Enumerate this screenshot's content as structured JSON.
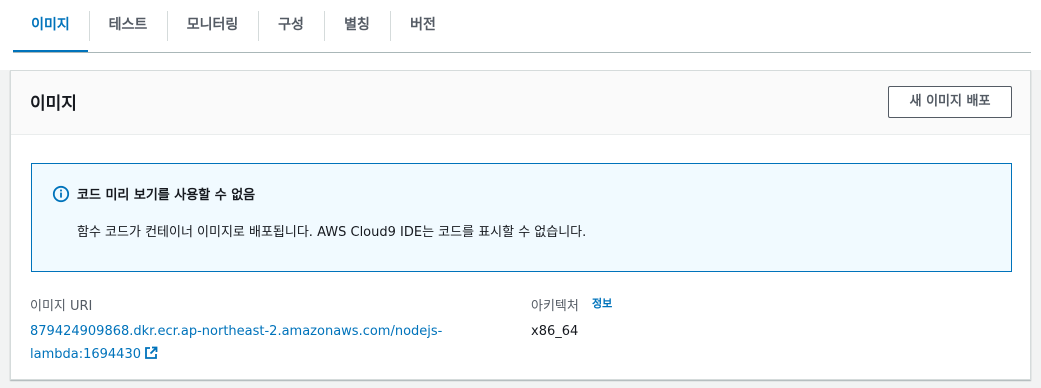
{
  "tabs": [
    {
      "label": "이미지",
      "active": true
    },
    {
      "label": "테스트",
      "active": false
    },
    {
      "label": "모니터링",
      "active": false
    },
    {
      "label": "구성",
      "active": false
    },
    {
      "label": "별칭",
      "active": false
    },
    {
      "label": "버전",
      "active": false
    }
  ],
  "panel": {
    "title": "이미지",
    "deploy_button_label": "새 이미지 배포"
  },
  "alert": {
    "icon": "info-icon",
    "title": "코드 미리 보기를 사용할 수 없음",
    "body": "함수 코드가 컨테이너 이미지로 배포됩니다. AWS Cloud9 IDE는 코드를 표시할 수 없습니다."
  },
  "details": {
    "image_uri_label": "이미지 URI",
    "image_uri_line1": "879424909868.dkr.ecr.ap-northeast-2.amazonaws.com/nodejs-",
    "image_uri_line2": "lambda:1694430",
    "external_link_icon": "external-link-icon",
    "architecture_label": "아키텍처",
    "architecture_info_link": "정보",
    "architecture_value": "x86_64"
  },
  "colors": {
    "accent": "#0073bb",
    "alert_bg": "#f1faff",
    "text": "#16191f",
    "secondary_text": "#545b64"
  }
}
